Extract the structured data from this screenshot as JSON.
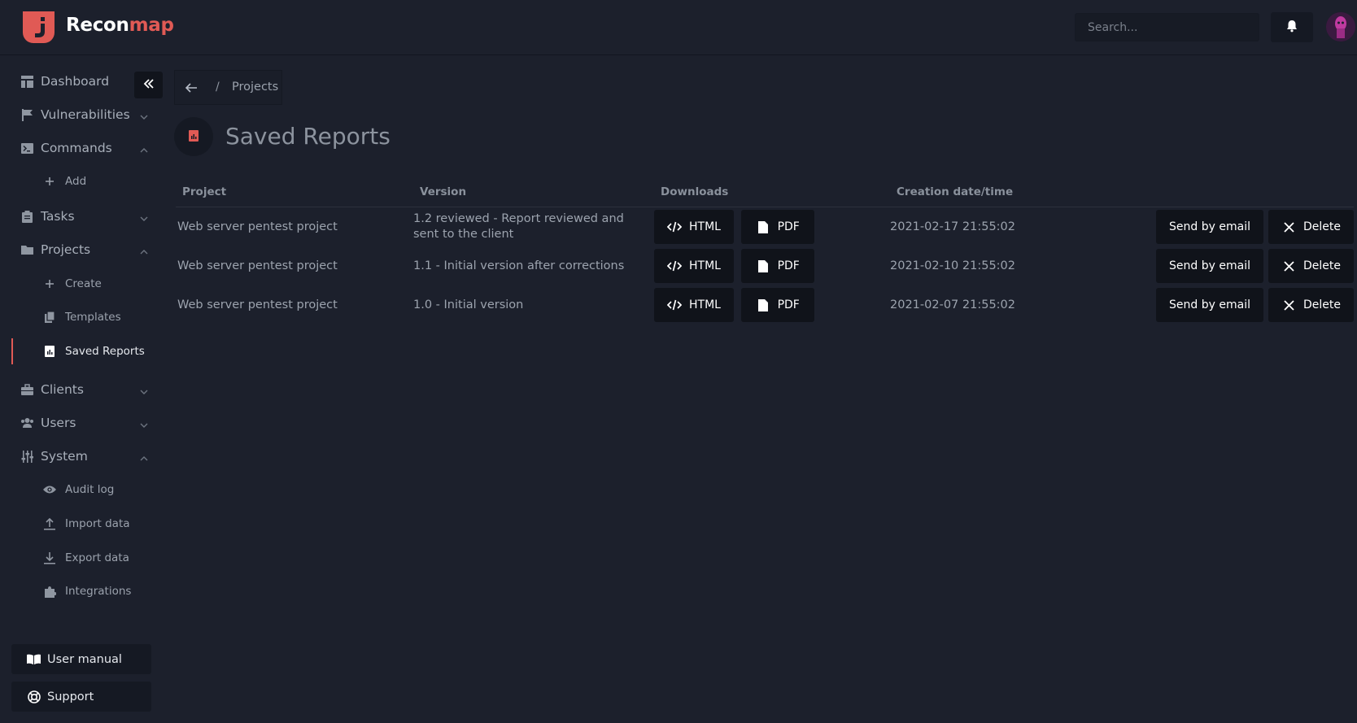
{
  "header": {
    "brand_part1": "Recon",
    "brand_part2": "map",
    "search_placeholder": "Search...",
    "accent_color": "#e05a55"
  },
  "sidebar": {
    "items": [
      {
        "label": "Dashboard",
        "icon": "dashboard-icon"
      },
      {
        "label": "Vulnerabilities",
        "icon": "flag-icon",
        "state": "collapsed"
      },
      {
        "label": "Commands",
        "icon": "terminal-icon",
        "state": "expanded"
      },
      {
        "label": "Tasks",
        "icon": "clipboard-icon",
        "state": "collapsed"
      },
      {
        "label": "Projects",
        "icon": "folder-icon",
        "state": "expanded"
      },
      {
        "label": "Clients",
        "icon": "briefcase-icon",
        "state": "collapsed"
      },
      {
        "label": "Users",
        "icon": "users-icon",
        "state": "collapsed"
      },
      {
        "label": "System",
        "icon": "sliders-icon",
        "state": "expanded"
      }
    ],
    "commands_sub": [
      {
        "label": "Add",
        "icon": "plus-icon"
      }
    ],
    "projects_sub": [
      {
        "label": "Create",
        "icon": "plus-icon"
      },
      {
        "label": "Templates",
        "icon": "copy-icon"
      },
      {
        "label": "Saved Reports",
        "icon": "report-icon",
        "active": true
      }
    ],
    "system_sub": [
      {
        "label": "Audit log",
        "icon": "eye-icon"
      },
      {
        "label": "Import data",
        "icon": "upload-icon"
      },
      {
        "label": "Export data",
        "icon": "download-icon"
      },
      {
        "label": "Integrations",
        "icon": "puzzle-icon"
      }
    ],
    "user_manual": "User manual",
    "support": "Support"
  },
  "breadcrumb": {
    "separator": "/",
    "crumb": "Projects"
  },
  "page": {
    "title": "Saved Reports"
  },
  "table": {
    "columns": [
      "Project",
      "Version",
      "Downloads",
      "Creation date/time"
    ],
    "rows": [
      {
        "project": "Web server pentest project",
        "version": "1.2 reviewed - Report reviewed and sent to the client",
        "html": "HTML",
        "pdf": "PDF",
        "created": "2021-02-17 21:55:02",
        "email": "Send by email",
        "delete": "Delete"
      },
      {
        "project": "Web server pentest project",
        "version": "1.1 - Initial version after corrections",
        "html": "HTML",
        "pdf": "PDF",
        "created": "2021-02-10 21:55:02",
        "email": "Send by email",
        "delete": "Delete"
      },
      {
        "project": "Web server pentest project",
        "version": "1.0 - Initial version",
        "html": "HTML",
        "pdf": "PDF",
        "created": "2021-02-07 21:55:02",
        "email": "Send by email",
        "delete": "Delete"
      }
    ]
  }
}
